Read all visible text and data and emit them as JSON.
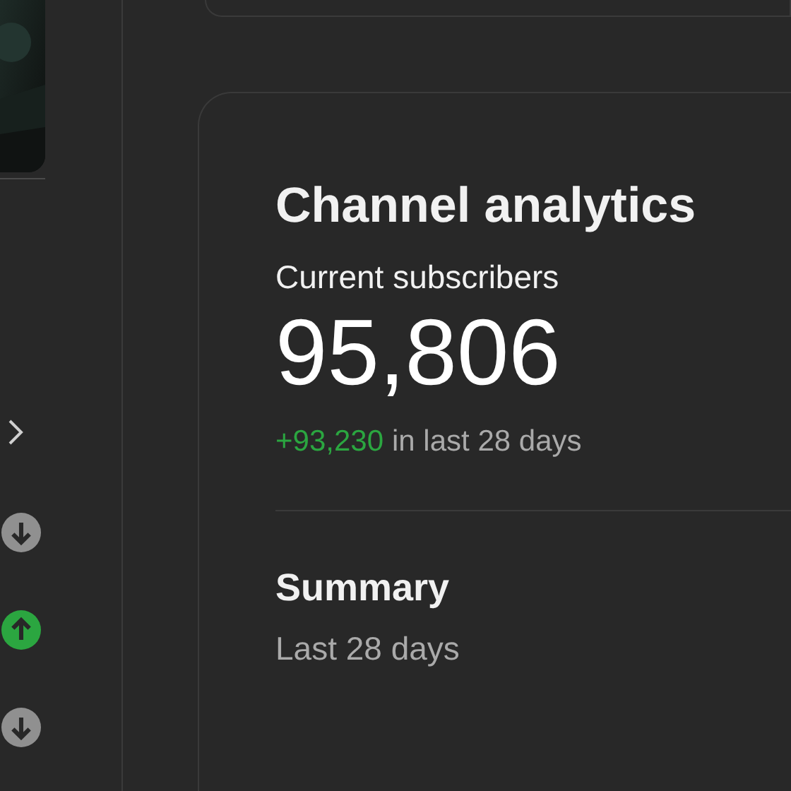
{
  "left_rail": {
    "trends": [
      {
        "kind": "down"
      },
      {
        "kind": "up"
      },
      {
        "kind": "down"
      }
    ]
  },
  "analytics_card": {
    "title": "Channel analytics",
    "subscribers_label": "Current subscribers",
    "subscribers": "95,806",
    "change": "+93,230",
    "change_period": "in last 28 days",
    "summary_title": "Summary",
    "summary_period": "Last 28 days"
  }
}
